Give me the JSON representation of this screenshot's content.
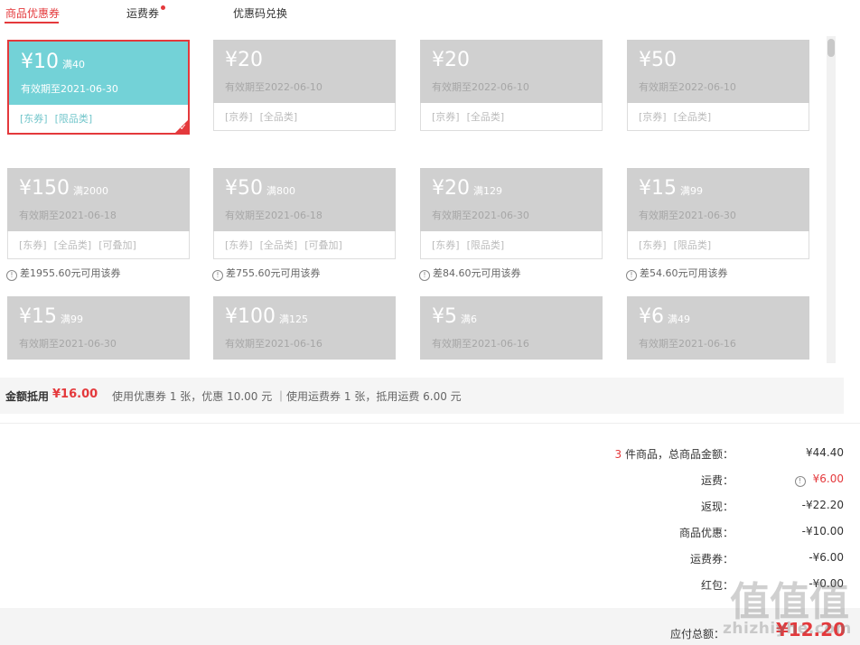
{
  "tabs": [
    {
      "label": "商品优惠券",
      "active": true
    },
    {
      "label": "运费券",
      "active": false,
      "dot": true
    },
    {
      "label": "优惠码兑换",
      "active": false
    }
  ],
  "coupons": [
    {
      "amount": "¥10",
      "min": "满40",
      "expiry": "有效期至2021-06-30",
      "tags": [
        "[东券]",
        "[限品类]"
      ],
      "selected": true
    },
    {
      "amount": "¥20",
      "min": "",
      "expiry": "有效期至2022-06-10",
      "tags": [
        "[京券]",
        "[全品类]"
      ]
    },
    {
      "amount": "¥20",
      "min": "",
      "expiry": "有效期至2022-06-10",
      "tags": [
        "[京券]",
        "[全品类]"
      ]
    },
    {
      "amount": "¥50",
      "min": "",
      "expiry": "有效期至2022-06-10",
      "tags": [
        "[京券]",
        "[全品类]"
      ]
    },
    {
      "amount": "¥150",
      "min": "满2000",
      "expiry": "有效期至2021-06-18",
      "tags": [
        "[东券]",
        "[全品类]",
        "[可叠加]"
      ],
      "hint": "差1955.60元可用该券"
    },
    {
      "amount": "¥50",
      "min": "满800",
      "expiry": "有效期至2021-06-18",
      "tags": [
        "[东券]",
        "[全品类]",
        "[可叠加]"
      ],
      "hint": "差755.60元可用该券"
    },
    {
      "amount": "¥20",
      "min": "满129",
      "expiry": "有效期至2021-06-30",
      "tags": [
        "[东券]",
        "[限品类]"
      ],
      "hint": "差84.60元可用该券"
    },
    {
      "amount": "¥15",
      "min": "满99",
      "expiry": "有效期至2021-06-30",
      "tags": [
        "[东券]",
        "[限品类]"
      ],
      "hint": "差54.60元可用该券"
    },
    {
      "amount": "¥15",
      "min": "满99",
      "expiry": "有效期至2021-06-30",
      "tags": []
    },
    {
      "amount": "¥100",
      "min": "满125",
      "expiry": "有效期至2021-06-16",
      "tags": []
    },
    {
      "amount": "¥5",
      "min": "满6",
      "expiry": "有效期至2021-06-16",
      "tags": []
    },
    {
      "amount": "¥6",
      "min": "满49",
      "expiry": "有效期至2021-06-16",
      "tags": []
    }
  ],
  "summary": {
    "label": "金额抵用",
    "amount": "¥16.00",
    "description": "使用优惠券 1 张，优惠 10.00 元 ｜使用运费券 1 张，抵用运费 6.00 元"
  },
  "totals": {
    "items_count": "3",
    "items_label": " 件商品，总商品金额：",
    "items_value": "¥44.40",
    "rows": [
      {
        "label": "运费：",
        "value": "¥6.00",
        "info": true,
        "highlight": true
      },
      {
        "label": "返现：",
        "value": "-¥22.20"
      },
      {
        "label": "商品优惠：",
        "value": "-¥10.00"
      },
      {
        "label": "运费券：",
        "value": "-¥6.00"
      },
      {
        "label": "红包：",
        "value": "-¥0.00"
      }
    ],
    "payable_label": "应付总额：",
    "payable_value": "¥12.20"
  },
  "watermark": {
    "glyphs": "值值值",
    "url": "zhizhiyhe.com"
  }
}
